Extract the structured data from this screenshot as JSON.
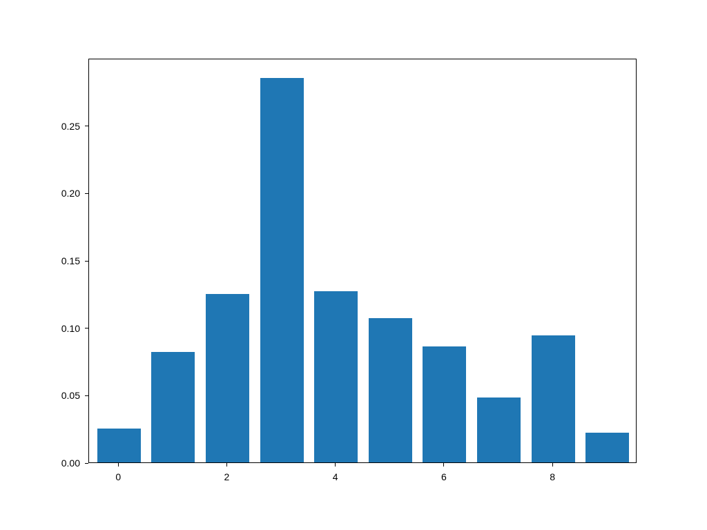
{
  "chart_data": {
    "type": "bar",
    "categories": [
      0,
      1,
      2,
      3,
      4,
      5,
      6,
      7,
      8,
      9
    ],
    "values": [
      0.025,
      0.082,
      0.125,
      0.285,
      0.127,
      0.107,
      0.086,
      0.048,
      0.094,
      0.022
    ],
    "title": "",
    "xlabel": "",
    "ylabel": "",
    "xlim": [
      -0.55,
      9.55
    ],
    "ylim": [
      0,
      0.3
    ],
    "y_ticks": [
      0.0,
      0.05,
      0.1,
      0.15,
      0.2,
      0.25
    ],
    "y_tick_labels": [
      "0.00",
      "0.05",
      "0.10",
      "0.15",
      "0.20",
      "0.25"
    ],
    "x_ticks": [
      0,
      2,
      4,
      6,
      8
    ],
    "x_tick_labels": [
      "0",
      "2",
      "4",
      "6",
      "8"
    ],
    "bar_width": 0.8,
    "bar_color": "#1f77b4"
  }
}
